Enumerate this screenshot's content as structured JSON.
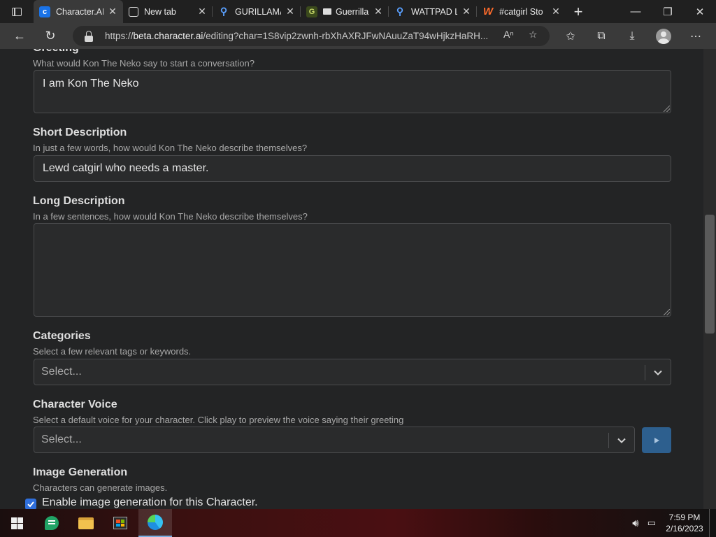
{
  "browser": {
    "tabs": [
      {
        "title": "Character.AI",
        "favicon": "character-ai-icon",
        "active": true
      },
      {
        "title": "New tab",
        "favicon": "newtab-icon",
        "active": false
      },
      {
        "title": "GURILLAMA",
        "favicon": "search-icon",
        "active": false
      },
      {
        "title": "Guerrilla",
        "favicon": "guerrilla-icon",
        "active": false
      },
      {
        "title": "WATTPAD L",
        "favicon": "search-icon",
        "active": false
      },
      {
        "title": "#catgirl Sto",
        "favicon": "wattpad-icon",
        "active": false
      }
    ],
    "url_prefix": "https://",
    "url_host": "beta.character.ai",
    "url_rest": "/editing?char=1S8vip2zwnh-rbXhAXRJFwNAuuZaT94wHjkzHaRH..."
  },
  "form": {
    "greeting": {
      "label": "Greeting",
      "hint": "What would Kon The Neko say to start a conversation?",
      "value": "I am Kon The Neko"
    },
    "short_description": {
      "label": "Short Description",
      "hint": "In just a few words, how would Kon The Neko describe themselves?",
      "value": "Lewd catgirl who needs a master."
    },
    "long_description": {
      "label": "Long Description",
      "hint": "In a few sentences, how would Kon The Neko describe themselves?",
      "value": ""
    },
    "categories": {
      "label": "Categories",
      "hint": "Select a few relevant tags or keywords.",
      "placeholder": "Select..."
    },
    "character_voice": {
      "label": "Character Voice",
      "hint": "Select a default voice for your character. Click play to preview the voice saying their greeting",
      "placeholder": "Select..."
    },
    "image_generation": {
      "label": "Image Generation",
      "hint": "Characters can generate images.",
      "checkbox_label": "Enable image generation for this Character.",
      "checked": true
    }
  },
  "taskbar": {
    "time": "7:59 PM",
    "date": "2/16/2023"
  },
  "colors": {
    "accent": "#2f6fdc",
    "play_button": "#2d5f8e",
    "page_bg": "#232425"
  }
}
